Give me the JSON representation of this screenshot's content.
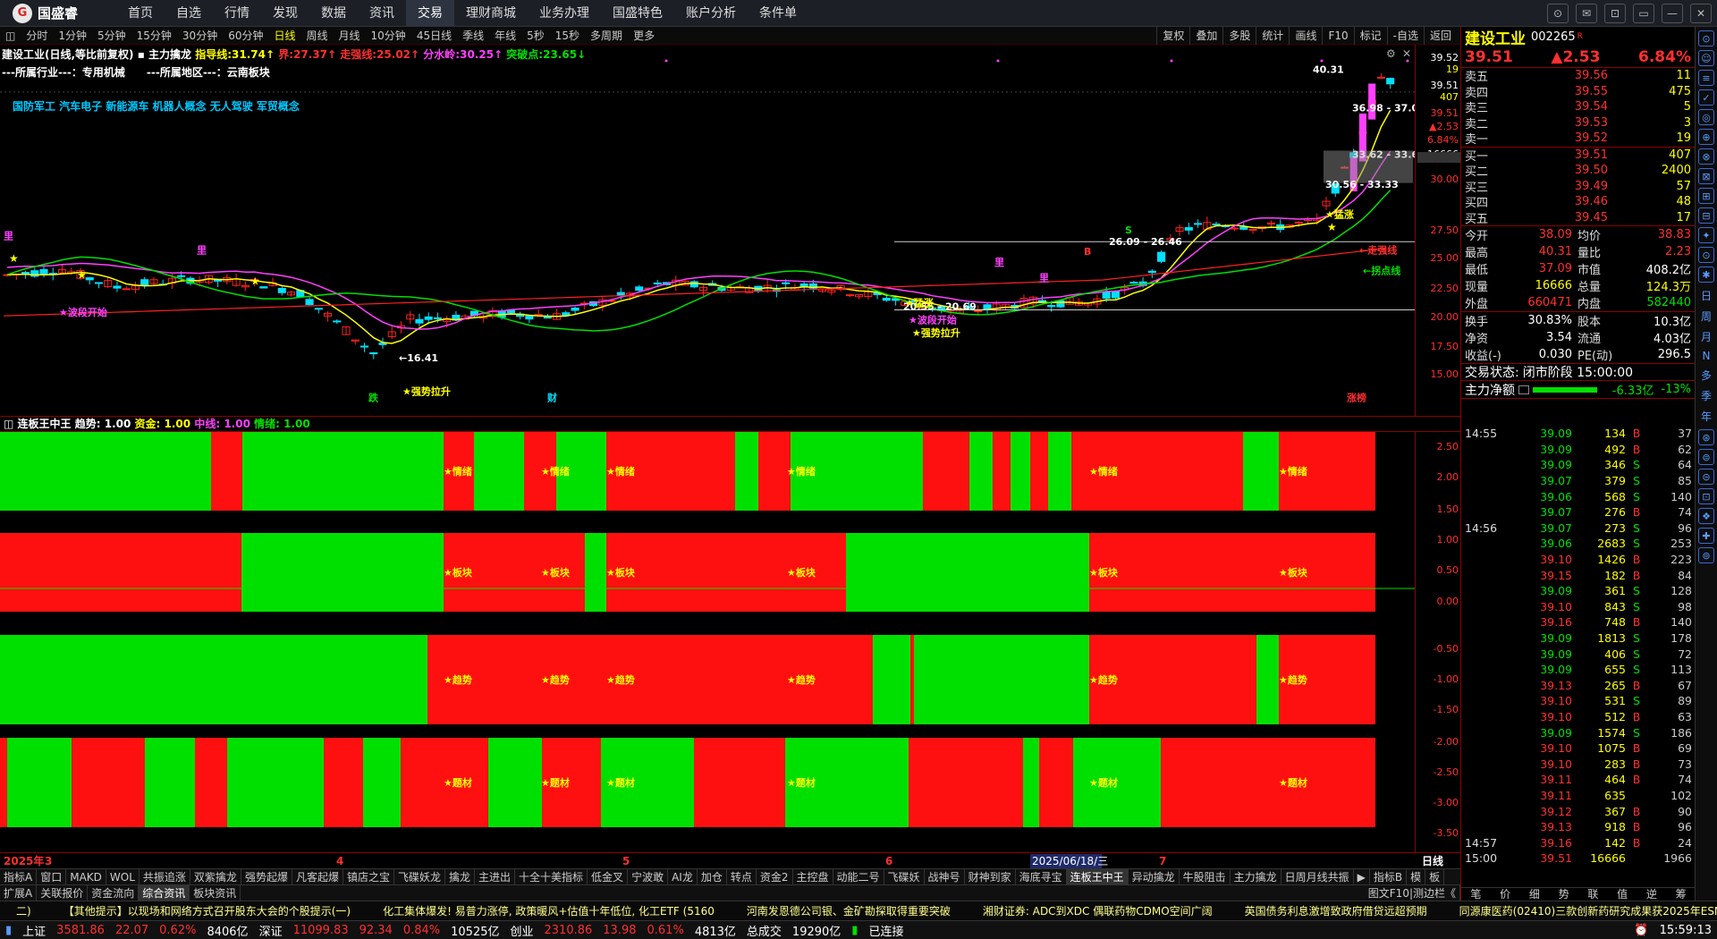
{
  "nav": {
    "logo": "国盛睿",
    "items": [
      "首页",
      "自选",
      "行情",
      "发现",
      "数据",
      "资讯",
      "交易",
      "理财商城",
      "业务办理",
      "国盛特色",
      "账户分析",
      "条件单"
    ],
    "active": 6,
    "winbtns": [
      "⊙",
      "✉",
      "⊡",
      "▭",
      "—",
      "✕"
    ]
  },
  "periods": {
    "items": [
      "分时",
      "1分钟",
      "5分钟",
      "15分钟",
      "30分钟",
      "60分钟",
      "日线",
      "周线",
      "月线",
      "10分钟",
      "45日线",
      "季线",
      "年线",
      "5秒",
      "15秒",
      "多周期",
      "更多"
    ],
    "active": 6,
    "tools": [
      "复权",
      "叠加",
      "多股",
      "统计",
      "画线",
      "F10",
      "标记",
      "-自选",
      "返回"
    ]
  },
  "kinfo": {
    "name": "建设工业(日线,等比前复权)",
    "ind": "主力擒龙",
    "zdx_label": "指导线:",
    "zdx": "31.74↑",
    "jie_label": "界:",
    "jie": "27.37↑",
    "zqx_label": "走强线:",
    "zqx": "25.02↑",
    "fsl_label": "分水岭:",
    "fsl": "30.25↑",
    "tpd_label": "突破点:",
    "tpd": "23.65↓"
  },
  "industry": "---所属行业---：专用机械　　---所属地区---：云南板块",
  "concepts": "国防军工 汽车电子 新能源车 机器人概念 无人驾驶 军贸概念",
  "chart_labels": {
    "hi": "40.31",
    "lo": "16.41",
    "r1": "36.98 - 37.0",
    "r2": "33.62 - 33.67",
    "r3": "30.56 - 33.33",
    "r4": "26.09 - 26.46",
    "r5": "20.55 - 20.69",
    "bd1": "★波段开始",
    "bd2": "★波段开始",
    "qs1": "★强势拉升",
    "qs2": "★强势拉升",
    "mz1": "★猛涨",
    "mz2": "★猛涨",
    "zqx": "←走强线",
    "tpd": "←拐点线",
    "die": "跌",
    "cai": "财",
    "zt": "涨榜",
    "li": "里",
    "S": "S",
    "B": "B"
  },
  "yaxis": [
    "39.52",
    "19",
    "39.51",
    "407",
    "39.51",
    "▲2.53",
    "6.84%",
    "16666",
    "30.00",
    "27.50",
    "25.00",
    "22.50",
    "20.00",
    "17.50",
    "15.00"
  ],
  "midbar": {
    "name": "连板王中王",
    "a": "趋势:",
    "av": "1.00",
    "b": "资金:",
    "bv": "1.00",
    "c": "中线:",
    "cv": "1.00",
    "d": "情绪:",
    "dv": "1.00"
  },
  "sub": {
    "labels": [
      "★情绪",
      "★板块",
      "★趋势",
      "★题材"
    ],
    "yaxis": [
      "2.50",
      "2.00",
      "1.50",
      "1.00",
      "0.50",
      "0.00",
      "-0.50",
      "-1.00",
      "-1.50",
      "-2.00",
      "-2.50",
      "-3.00",
      "-3.50"
    ]
  },
  "dates": {
    "y": "2025年",
    "m3": "3",
    "m4": "4",
    "m5": "5",
    "m6": "6",
    "sel": "2025/06/18/三",
    "m7": "7",
    "period": "日线"
  },
  "tabs1": [
    "指标A",
    "窗口",
    "MAKD",
    "WOL",
    "共振追涨",
    "双紫擒龙",
    "强势起爆",
    "凡客起爆",
    "镇店之宝",
    "飞碟妖龙",
    "擒龙",
    "主进出",
    "十全十美指标",
    "低金叉",
    "宁波敢",
    "AI龙",
    "加仓",
    "转点",
    "资金2",
    "主控盘",
    "动能二号",
    "飞碟妖",
    "战神号",
    "财神到家",
    "海底寻宝",
    "连板王中王",
    "异动擒龙",
    "牛股阻击",
    "主力擒龙",
    "日周月线共振",
    "▶",
    "指标B",
    "模",
    "板"
  ],
  "tabs1_active": 25,
  "tabs2": [
    "扩展A",
    "关联报价",
    "资金流向",
    "综合资讯",
    "板块资讯"
  ],
  "tabs2_active": 3,
  "tabs2_right": "图文F10|测边栏《",
  "news": [
    "二)",
    "【其他提示】以现场和网络方式召开股东大会的个股提示(一)",
    "化工集体爆发! 易普力涨停, 政策暖风+估值十年低位, 化工ETF (5160",
    "河南发恩德公司银、金矿勘探取得重要突破",
    "湘财证券: ADC到XDC 偶联药物CDMO空间广阔",
    "英国债务利息激增致政府借贷远超预期",
    "同源康医药(02410)三款创新药研究成果获2025年ESMO大"
  ],
  "status": {
    "sh": "上证",
    "shv": "3581.86",
    "shc": "22.07",
    "shp": "0.62%",
    "sha": "8406亿",
    "sz": "深证",
    "szv": "11099.83",
    "szc": "92.34",
    "szp": "0.84%",
    "sza": "10525亿",
    "cy": "创业",
    "cyv": "2310.86",
    "cyc": "13.98",
    "cyp": "0.61%",
    "cya": "4813亿",
    "zc": "总成交",
    "zcv": "19290亿",
    "conn": "已连接",
    "time": "15:59:13"
  },
  "right": {
    "name": "建设工业",
    "code": "002265",
    "code_tag": "R",
    "price": "39.51",
    "change": "▲2.53",
    "pct": "6.84%",
    "asks": [
      [
        "卖五",
        "39.56",
        "11"
      ],
      [
        "卖四",
        "39.55",
        "475"
      ],
      [
        "卖三",
        "39.54",
        "5"
      ],
      [
        "卖二",
        "39.53",
        "3"
      ],
      [
        "卖一",
        "39.52",
        "19"
      ]
    ],
    "bids": [
      [
        "买一",
        "39.51",
        "407"
      ],
      [
        "买二",
        "39.50",
        "2400"
      ],
      [
        "买三",
        "39.49",
        "57"
      ],
      [
        "买四",
        "39.46",
        "48"
      ],
      [
        "买五",
        "39.45",
        "17"
      ]
    ],
    "stats": [
      [
        "今开",
        "38.09",
        "均价",
        "38.83"
      ],
      [
        "最高",
        "40.31",
        "量比",
        "2.23"
      ],
      [
        "最低",
        "37.09",
        "市值",
        "408.2亿"
      ],
      [
        "现量",
        "16666",
        "总量",
        "124.3万"
      ],
      [
        "外盘",
        "660471",
        "内盘",
        "582440"
      ]
    ],
    "stats2": [
      [
        "换手",
        "30.83%",
        "股本",
        "10.3亿"
      ],
      [
        "净资",
        "3.54",
        "流通",
        "4.03亿"
      ],
      [
        "收益(-)",
        "0.030",
        "PE(动)",
        "296.5"
      ]
    ],
    "state_label": "交易状态:",
    "state": "闭市阶段 15:00:00",
    "zljl": "主力净额",
    "zljv": "-6.33亿",
    "zljp": "-13%",
    "ticks": [
      [
        "14:55",
        "39.09",
        "134",
        "B",
        "37"
      ],
      [
        "",
        "39.09",
        "492",
        "B",
        "62"
      ],
      [
        "",
        "39.09",
        "346",
        "S",
        "64"
      ],
      [
        "",
        "39.07",
        "379",
        "S",
        "85"
      ],
      [
        "",
        "39.06",
        "568",
        "S",
        "140"
      ],
      [
        "",
        "39.07",
        "276",
        "B",
        "74"
      ],
      [
        "14:56",
        "39.07",
        "273",
        "S",
        "96"
      ],
      [
        "",
        "39.06",
        "2683",
        "S",
        "253"
      ],
      [
        "",
        "39.10",
        "1426",
        "B",
        "223"
      ],
      [
        "",
        "39.15",
        "182",
        "B",
        "84"
      ],
      [
        "",
        "39.09",
        "361",
        "S",
        "128"
      ],
      [
        "",
        "39.10",
        "843",
        "S",
        "98"
      ],
      [
        "",
        "39.16",
        "748",
        "B",
        "140"
      ],
      [
        "",
        "39.09",
        "1813",
        "S",
        "178"
      ],
      [
        "",
        "39.09",
        "406",
        "S",
        "72"
      ],
      [
        "",
        "39.09",
        "655",
        "S",
        "113"
      ],
      [
        "",
        "39.13",
        "265",
        "B",
        "67"
      ],
      [
        "",
        "39.10",
        "531",
        "S",
        "89"
      ],
      [
        "",
        "39.10",
        "512",
        "B",
        "63"
      ],
      [
        "",
        "39.09",
        "1574",
        "S",
        "186"
      ],
      [
        "",
        "39.10",
        "1075",
        "B",
        "69"
      ],
      [
        "",
        "39.10",
        "283",
        "B",
        "73"
      ],
      [
        "",
        "39.11",
        "464",
        "B",
        "74"
      ],
      [
        "",
        "39.11",
        "635",
        "",
        "102"
      ],
      [
        "",
        "39.12",
        "367",
        "B",
        "90"
      ],
      [
        "",
        "39.13",
        "918",
        "B",
        "96"
      ],
      [
        "14:57",
        "39.16",
        "142",
        "B",
        "24"
      ],
      [
        "15:00",
        "39.51",
        "16666",
        "",
        "1966"
      ]
    ],
    "tabs": [
      "笔",
      "价",
      "细",
      "势",
      "联",
      "值",
      "逆",
      "筹"
    ]
  },
  "sidebar": [
    "⊙",
    "☺",
    "≡",
    "✓",
    "◎",
    "⊕",
    "⊗",
    "⊠",
    "⊞",
    "⊟",
    "✦",
    "⊙",
    "✱",
    "⊛",
    "⊜",
    "⊝",
    "⊡",
    "❖",
    "✚",
    "⊚"
  ],
  "sidebar_text": [
    "日",
    "周",
    "月",
    "N",
    "多",
    "季",
    "年"
  ]
}
